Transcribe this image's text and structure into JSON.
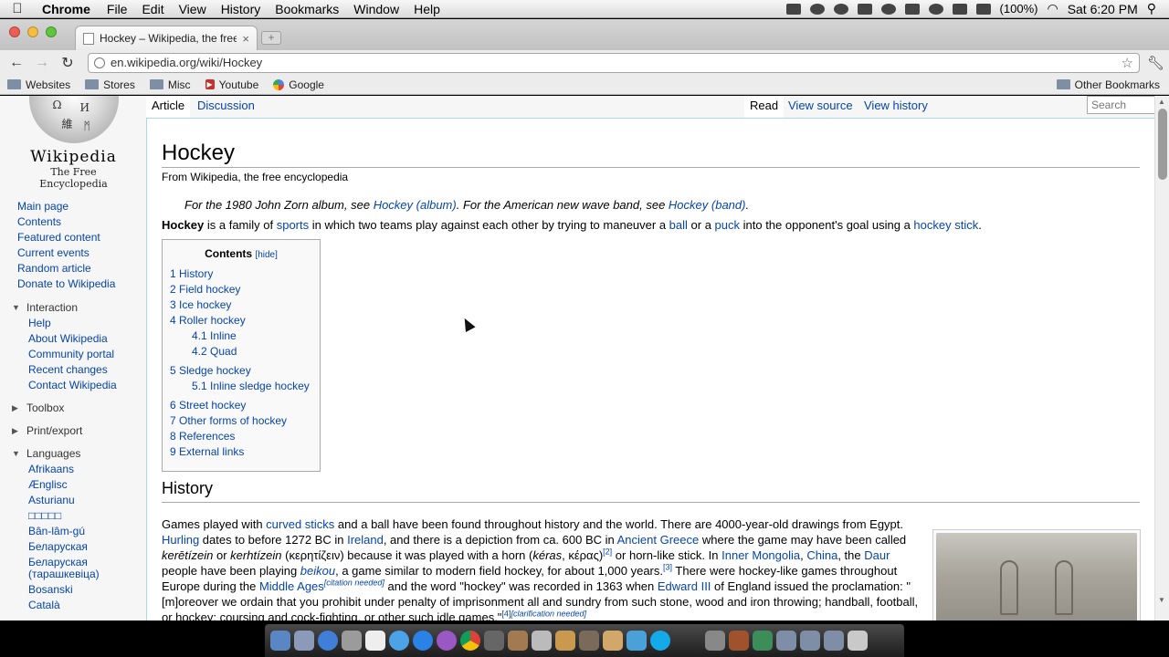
{
  "menubar": {
    "app": "Chrome",
    "items": [
      "File",
      "Edit",
      "View",
      "History",
      "Bookmarks",
      "Window",
      "Help"
    ],
    "battery": "(100%)",
    "clock": "Sat 6:20 PM"
  },
  "browser": {
    "tab_title": "Hockey – Wikipedia, the free",
    "url": "en.wikipedia.org/wiki/Hockey",
    "bookmarks": [
      "Websites",
      "Stores",
      "Misc",
      "Youtube",
      "Google"
    ],
    "bookmarks_right": "Other Bookmarks"
  },
  "wiki": {
    "wordmark": "Wikipedia",
    "tagline": "The Free Encyclopedia",
    "nav": [
      "Main page",
      "Contents",
      "Featured content",
      "Current events",
      "Random article",
      "Donate to Wikipedia"
    ],
    "interaction_label": "Interaction",
    "interaction": [
      "Help",
      "About Wikipedia",
      "Community portal",
      "Recent changes",
      "Contact Wikipedia"
    ],
    "toolbox": "Toolbox",
    "print": "Print/export",
    "languages_label": "Languages",
    "languages": [
      "Afrikaans",
      "Ænglisc",
      "Asturianu",
      "□□□□□",
      "Bân-lâm-gú",
      "Беларуская",
      "Беларуская (тарашкевіца)",
      "Bosanski",
      "Català"
    ],
    "tabs": {
      "article": "Article",
      "discussion": "Discussion",
      "read": "Read",
      "view_source": "View source",
      "view_history": "View history",
      "search_placeholder": "Search"
    }
  },
  "article": {
    "title": "Hockey",
    "from": "From Wikipedia, the free encyclopedia",
    "hatnote": {
      "t1": "For the 1980 John Zorn album, see ",
      "l1": "Hockey (album)",
      "t2": ". For the American new wave band, see ",
      "l2": "Hockey (band)",
      "t3": "."
    },
    "lead": {
      "bold": "Hockey",
      "t1": " is a family of ",
      "l1": "sports",
      "t2": " in which two teams play against each other by trying to maneuver a ",
      "l2": "ball",
      "t3": " or a ",
      "l3": "puck",
      "t4": " into the opponent's goal using a ",
      "l4": "hockey stick",
      "t5": "."
    },
    "toc": {
      "title": "Contents",
      "hide": "[hide]",
      "entries": [
        "1 History",
        "2 Field hockey",
        "3 Ice hockey",
        "4 Roller hockey",
        "4.1 Inline",
        "4.2 Quad",
        "5 Sledge hockey",
        "5.1 Inline sledge hockey",
        "6 Street hockey",
        "7 Other forms of hockey",
        "8 References",
        "9 External links"
      ]
    },
    "history_heading": "History",
    "history": {
      "p1": "Games played with ",
      "l1": "curved sticks",
      "p2": " and a ball have been found throughout history and the world. There are 4000-year-old drawings from Egypt. ",
      "l2": "Hurling",
      "p3": " dates to before 1272 BC in ",
      "l3": "Ireland",
      "p4": ", and there is a depiction from ca. 600 BC in ",
      "l4": "Ancient Greece",
      "p5": " where the game may have been called ",
      "i1": "kerētízein",
      "p6": " or ",
      "i2": "kerhtízein",
      "p7": " (κερητίζειν) because it was played with a horn (",
      "i3": "kéras",
      "p8": ", κέρας)",
      "s1": "[2]",
      "p9": " or horn-like stick. In ",
      "l5": "Inner Mongolia",
      "p10": ", ",
      "l6": "China",
      "p11": ", the ",
      "l7": "Daur",
      "p12": " people have been playing ",
      "l8": "beikou",
      "p13": ", a game similar to modern field hockey, for about 1,000 years.",
      "s2": "[3]",
      "p14": " There were hockey-like games throughout Europe during the ",
      "l9": "Middle Ages",
      "s3": "[citation needed]",
      "p15": " and the word \"hockey\" was recorded in 1363 when ",
      "l10": "Edward III",
      "p16": " of England issued the proclamation: \"[m]oreover we ordain that you prohibit under penalty of imprisonment all and sundry from such stone, wood and iron throwing; handball, football, or hockey; coursing and cock-fighting, or other such idle games.\"",
      "s4": "[4]",
      "s5": "[clarification needed]"
    }
  }
}
